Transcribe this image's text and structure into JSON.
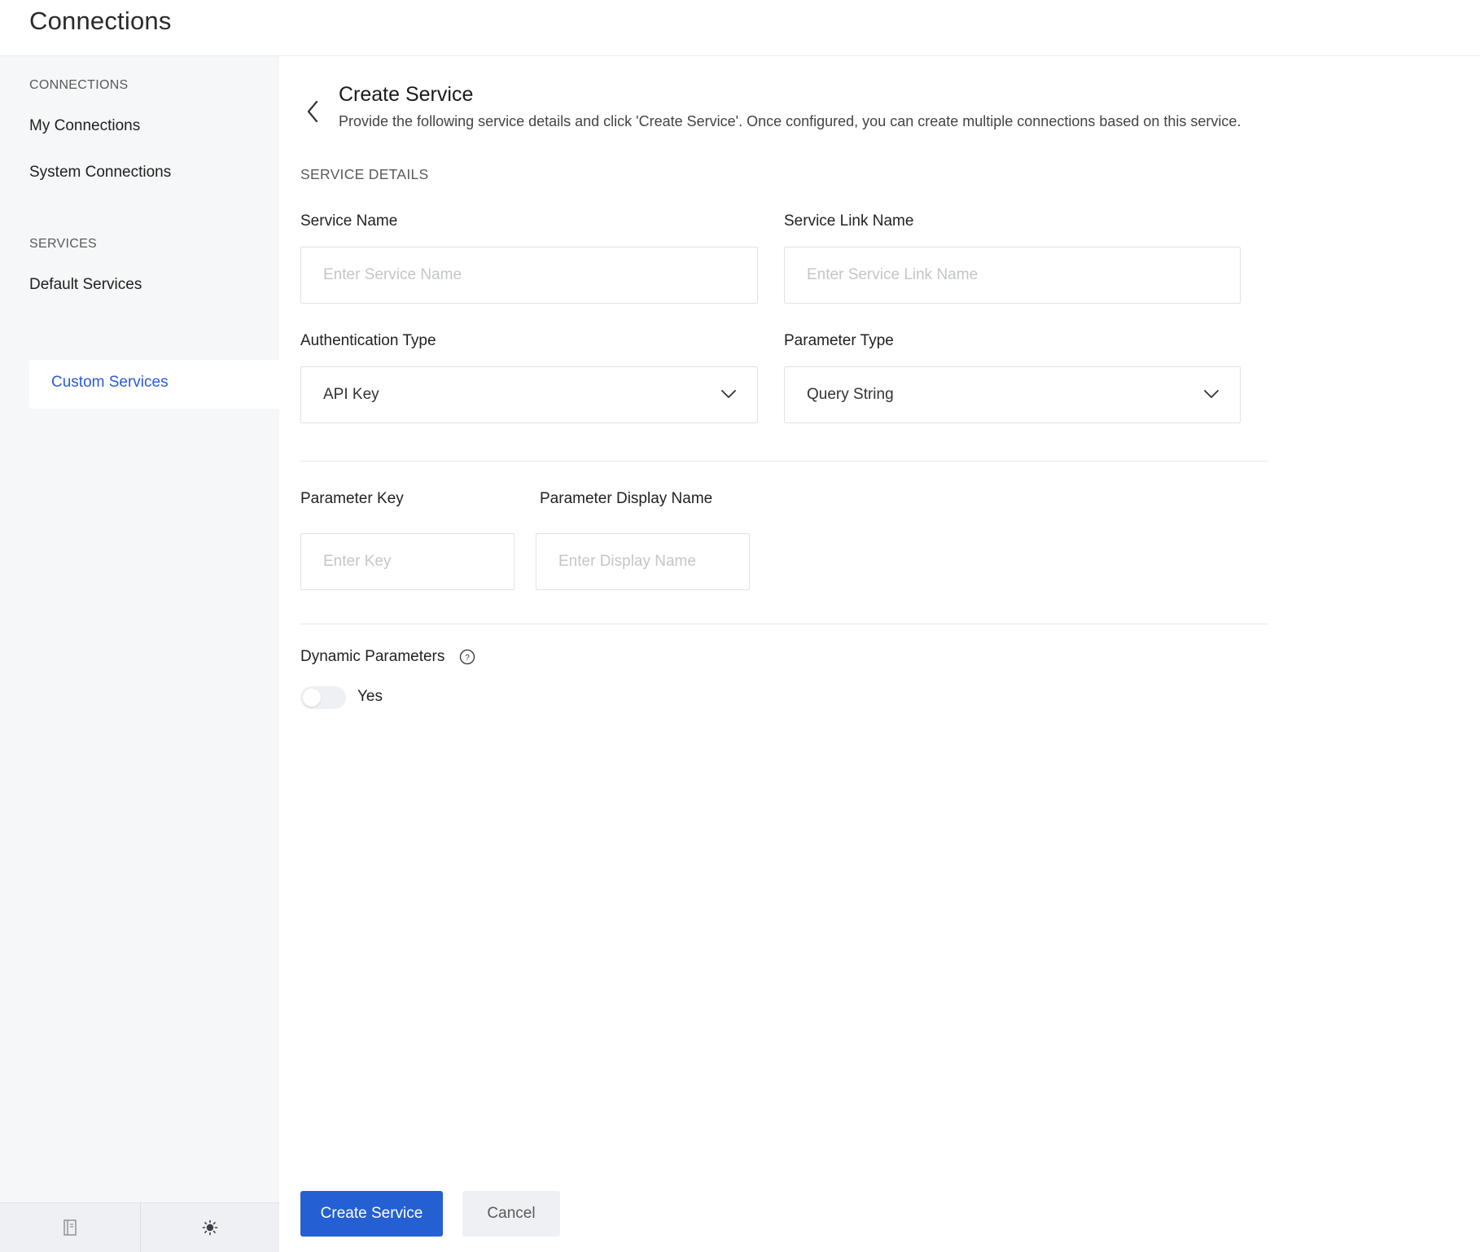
{
  "app": {
    "title": "Connections"
  },
  "sidebar": {
    "sections": [
      {
        "title": "CONNECTIONS",
        "items": [
          {
            "label": "My Connections"
          },
          {
            "label": "System Connections"
          }
        ]
      },
      {
        "title": "SERVICES",
        "items": [
          {
            "label": "Default Services"
          },
          {
            "label": "Custom Services",
            "active": true
          }
        ]
      }
    ],
    "footer": {
      "icons": [
        "notebook-icon",
        "sun-icon"
      ]
    }
  },
  "main": {
    "title": "Create Service",
    "description": "Provide the following service details and click 'Create Service'. Once configured, you can create multiple connections based on this service.",
    "section_title": "SERVICE DETAILS",
    "fields": {
      "service_name": {
        "label": "Service Name",
        "placeholder": "Enter Service Name",
        "value": ""
      },
      "service_link_name": {
        "label": "Service Link Name",
        "placeholder": "Enter Service Link Name",
        "value": ""
      },
      "authentication_type": {
        "label": "Authentication Type",
        "value": "API Key"
      },
      "parameter_type": {
        "label": "Parameter Type",
        "value": "Query String"
      },
      "parameter_key": {
        "label": "Parameter Key",
        "placeholder": "Enter Key",
        "value": ""
      },
      "parameter_display_name": {
        "label": "Parameter Display Name",
        "placeholder": "Enter Display Name",
        "value": ""
      }
    },
    "dynamic_parameters": {
      "label": "Dynamic Parameters",
      "toggle_label": "Yes",
      "enabled": false
    },
    "buttons": {
      "create": "Create Service",
      "cancel": "Cancel"
    }
  },
  "colors": {
    "accent": "#2460d1",
    "active_link": "#2a5bd7",
    "sidebar_bg": "#f6f7f9",
    "border": "#e1e2e5"
  }
}
